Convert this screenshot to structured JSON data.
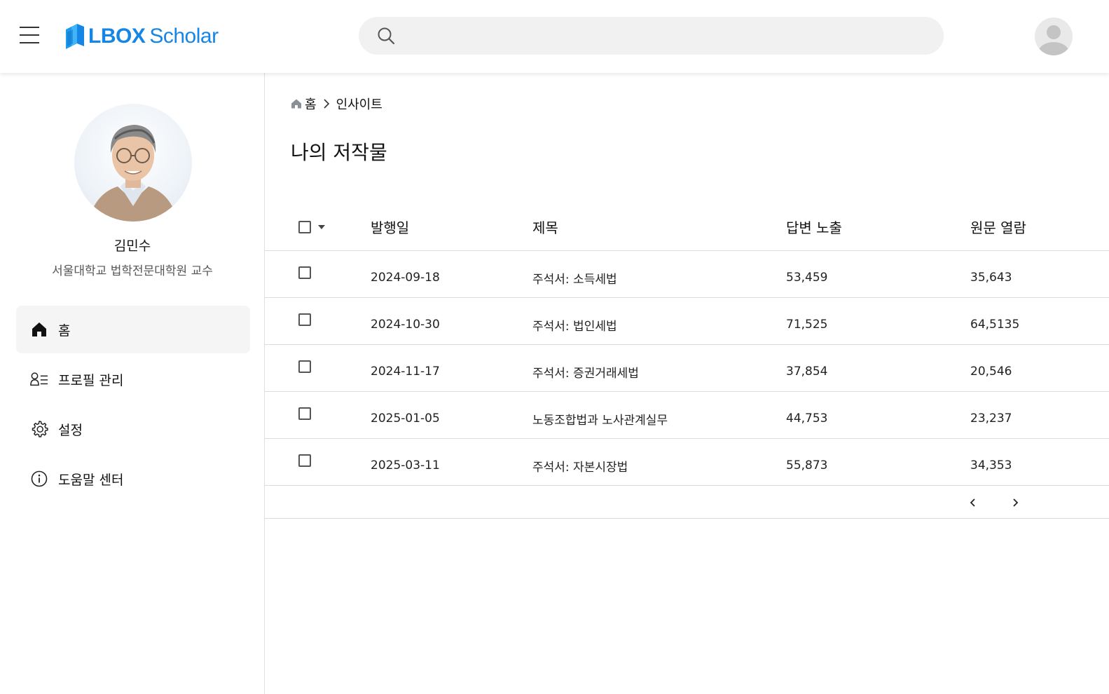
{
  "header": {
    "logo_bold": "LBOX",
    "logo_light": "Scholar",
    "search_placeholder": ""
  },
  "profile": {
    "name": "김민수",
    "title": "서울대학교 법학전문대학원 교수"
  },
  "sidebar": {
    "items": [
      {
        "label": "홈",
        "icon": "home-icon",
        "active": true
      },
      {
        "label": "프로필 관리",
        "icon": "profile-list-icon",
        "active": false
      },
      {
        "label": "설정",
        "icon": "gear-icon",
        "active": false
      },
      {
        "label": "도움말 센터",
        "icon": "info-icon",
        "active": false
      }
    ]
  },
  "breadcrumb": {
    "home": "홈",
    "current": "인사이트"
  },
  "page": {
    "title": "나의 저작물"
  },
  "table": {
    "columns": [
      "발행일",
      "제목",
      "답변 노출",
      "원문 열람"
    ],
    "rows": [
      {
        "date": "2024-09-18",
        "title": "주석서: 소득세법",
        "exposure": "53,459",
        "views": "35,643"
      },
      {
        "date": "2024-10-30",
        "title": "주석서: 법인세법",
        "exposure": "71,525",
        "views": "64,5135"
      },
      {
        "date": "2024-11-17",
        "title": "주석서: 증권거래세법",
        "exposure": "37,854",
        "views": "20,546"
      },
      {
        "date": "2025-01-05",
        "title": "노동조합법과 노사관계실무",
        "exposure": "44,753",
        "views": "23,237"
      },
      {
        "date": "2025-03-11",
        "title": "주석서: 자본시장법",
        "exposure": "55,873",
        "views": "34,353"
      }
    ]
  },
  "colors": {
    "brand": "#1585e6",
    "active_bg": "#f5f5f5",
    "divider": "#dcdcdc"
  }
}
